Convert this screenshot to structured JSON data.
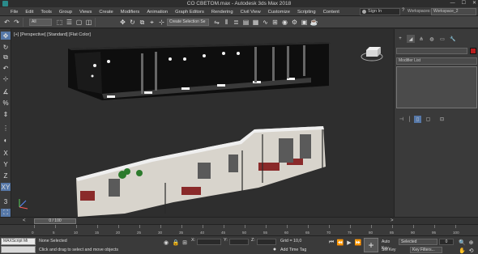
{
  "window": {
    "title": "CO CBETOM.max - Autodesk 3ds Max 2018",
    "minimize": "—",
    "maximize": "☐",
    "close": "✕"
  },
  "menu": {
    "items": [
      "File",
      "Edit",
      "Tools",
      "Group",
      "Views",
      "Create",
      "Modifiers",
      "Animation",
      "Graph Editors",
      "Rendering",
      "Civil View",
      "Customize",
      "Scripting",
      "Content"
    ]
  },
  "account": {
    "sign_in": "Sign In",
    "help": "?",
    "workspaces_label": "Workspaces:",
    "workspace": "Workspace_2"
  },
  "toolbar": {
    "filter": "All",
    "selection_set": "Create Selection Se"
  },
  "viewport": {
    "label": "[+] [Perspective] [Standard] [Flat Color]"
  },
  "command_panel": {
    "modifier_list": "Modifier List"
  },
  "timeline": {
    "slider": "0 / 100",
    "left_arrow": "<",
    "right_arrow": ">"
  },
  "trackbar": {
    "ticks": [
      "0",
      "5",
      "10",
      "15",
      "20",
      "25",
      "30",
      "35",
      "40",
      "45",
      "50",
      "55",
      "60",
      "65",
      "70",
      "75",
      "80",
      "85",
      "90",
      "95",
      "100"
    ]
  },
  "status": {
    "maxscript": "MAXScript Mi",
    "selection": "None Selected",
    "prompt": "Click and drag to select and move objects",
    "x_label": "X:",
    "y_label": "Y:",
    "z_label": "Z:",
    "grid": "Grid = 10,0",
    "add_time_tag": "Add Time Tag",
    "auto_key": "Auto Key",
    "set_key": "Set Key",
    "key_mode": "Selected",
    "key_filters": "Key Filters...",
    "frame": "0"
  },
  "colors": {
    "accent": "#5678a8",
    "object_color": "#b81f1f"
  }
}
